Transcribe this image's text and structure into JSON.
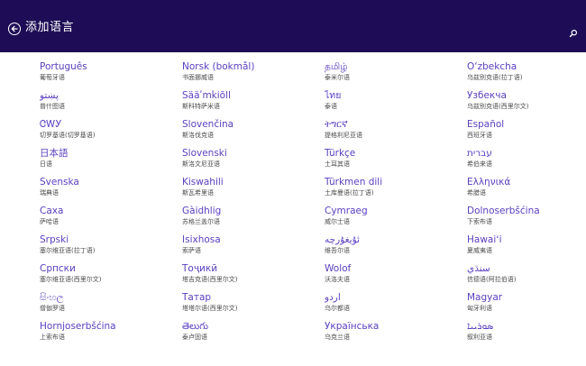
{
  "header": {
    "title": "添加语言",
    "background_color": "#1e0d56",
    "back_icon": "back-arrow-icon",
    "search_icon": "search-icon"
  },
  "accent_color": "#5a3fc0",
  "languages": [
    {
      "native": "Português",
      "local": "葡萄牙语"
    },
    {
      "native": "پښتو",
      "local": "普什图语"
    },
    {
      "native": "ᏣᎳᎩ",
      "local": "切罗基语(切罗基语)"
    },
    {
      "native": "日本語",
      "local": "日语"
    },
    {
      "native": "Svenska",
      "local": "瑞典语"
    },
    {
      "native": "Саха",
      "local": "萨哈语"
    },
    {
      "native": "Srpski",
      "local": "塞尔维亚语(拉丁语)"
    },
    {
      "native": "Српски",
      "local": "塞尔维亚语(西里尔文)"
    },
    {
      "native": "සිංහල",
      "local": "僧伽罗语"
    },
    {
      "native": "Hornjoserbšćina",
      "local": "上索布语"
    },
    {
      "native": "Norsk (bokmål)",
      "local": "书面挪威语"
    },
    {
      "native": "Sääʹmǩiõll",
      "local": "斯科特萨米语"
    },
    {
      "native": "Slovenčina",
      "local": "斯洛伐克语"
    },
    {
      "native": "Slovenski",
      "local": "斯洛文尼亚语"
    },
    {
      "native": "Kiswahili",
      "local": "斯瓦希里语"
    },
    {
      "native": "Gàidhlig",
      "local": "苏格兰盖尔语"
    },
    {
      "native": "Isixhosa",
      "local": "索萨语"
    },
    {
      "native": "Тоҷикӣ",
      "local": "塔吉克语(西里尔文)"
    },
    {
      "native": "Татар",
      "local": "塔塔尔语(西里尔文)"
    },
    {
      "native": "తెలుగు",
      "local": "泰卢固语"
    },
    {
      "native": "தமிழ்",
      "local": "泰米尔语"
    },
    {
      "native": "ไทย",
      "local": "泰语"
    },
    {
      "native": "ትግርኛ",
      "local": "提格利尼亚语"
    },
    {
      "native": "Türkçe",
      "local": "土耳其语"
    },
    {
      "native": "Türkmen dili",
      "local": "土库曼语(拉丁语)"
    },
    {
      "native": "Cymraeg",
      "local": "威尔士语"
    },
    {
      "native": "ئۇيغۇرچە",
      "local": "维吾尔语"
    },
    {
      "native": "Wolof",
      "local": "沃洛夫语"
    },
    {
      "native": "اُردو",
      "local": "乌尔都语"
    },
    {
      "native": "Українська",
      "local": "乌克兰语"
    },
    {
      "native": "O‘zbekcha",
      "local": "乌兹别克语(拉丁语)"
    },
    {
      "native": "Ўзбекча",
      "local": "乌兹别克语(西里尔文)"
    },
    {
      "native": "Español",
      "local": "西班牙语"
    },
    {
      "native": "עברית",
      "local": "希伯来语"
    },
    {
      "native": "Ελληνικά",
      "local": "希腊语"
    },
    {
      "native": "Dolnoserbšćina",
      "local": "下索布语"
    },
    {
      "native": "Hawaiʻi",
      "local": "夏威夷语"
    },
    {
      "native": "سنڌي",
      "local": "信德语(阿拉伯语)"
    },
    {
      "native": "Magyar",
      "local": "匈牙利语"
    },
    {
      "native": "ܣܘܪܝܝܐ",
      "local": "叙利亚语"
    }
  ]
}
